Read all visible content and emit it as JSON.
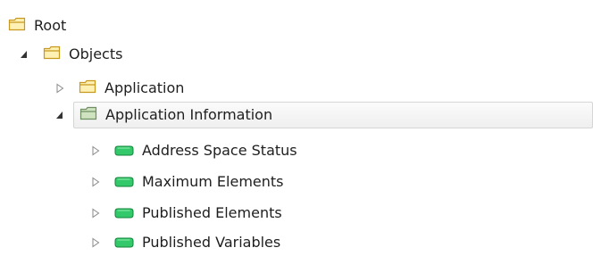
{
  "tree": {
    "nodes": [
      {
        "label": "Root",
        "icon": "folder-icon",
        "expander": "none"
      },
      {
        "label": "Objects",
        "icon": "folder-icon",
        "expander": "expanded"
      },
      {
        "label": "Application",
        "icon": "folder-icon",
        "expander": "collapsed"
      },
      {
        "label": "Application Information",
        "icon": "folder-icon",
        "expander": "expanded",
        "selected": true
      },
      {
        "label": "Address Space Status",
        "icon": "variable-tag-icon",
        "expander": "collapsed"
      },
      {
        "label": "Maximum Elements",
        "icon": "variable-tag-icon",
        "expander": "collapsed"
      },
      {
        "label": "Published Elements",
        "icon": "variable-tag-icon",
        "expander": "collapsed"
      },
      {
        "label": "Published Variables",
        "icon": "variable-tag-icon",
        "expander": "collapsed"
      }
    ]
  },
  "colors": {
    "folder_fill": "#fff0b3",
    "folder_stroke": "#c79a1f",
    "selected_folder_fill": "#cfe3c1",
    "selected_folder_stroke": "#6f8f62",
    "tag_fill": "#33c96a",
    "tag_stroke": "#11843b",
    "selection_border": "#d6d6d6"
  }
}
